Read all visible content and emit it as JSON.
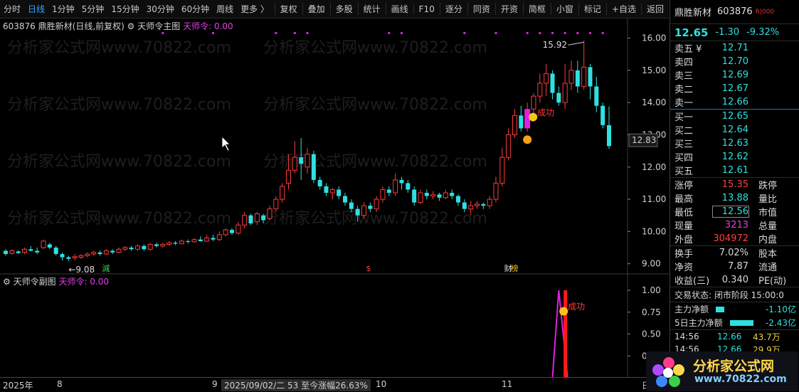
{
  "toolbar": {
    "tabs": [
      "分时",
      "日线",
      "1分钟",
      "5分钟",
      "15分钟",
      "30分钟",
      "60分钟",
      "周线",
      "更多 〉"
    ],
    "active_tab": "日线",
    "tools": [
      "复权",
      "叠加",
      "多股",
      "统计",
      "画线",
      "F10",
      "逐分",
      "同资",
      "开资",
      "简框",
      "小窗",
      "标记",
      "+自选",
      "返回"
    ]
  },
  "main_chart": {
    "code": "603876",
    "title": "鼎胜新材(日线,前复权)",
    "indicator_name": "天师令主图",
    "indicator_value": "天师令: 0.00",
    "y_ticks": [
      "16.00",
      "15.00",
      "14.00",
      "13.00",
      "12.00",
      "11.00",
      "10.00",
      "9.00"
    ],
    "current_price_label": "12.83",
    "high_label": "15.92",
    "low_label": "9.08",
    "success_label": "成功",
    "markers": [
      "減",
      "$",
      "财",
      "榜"
    ]
  },
  "sub_chart": {
    "title": "天师令副图",
    "indicator_value": "天师令: 0.00",
    "y_ticks": [
      "1.00",
      "0.75",
      "0.50",
      "0.25"
    ],
    "success_label": "成功"
  },
  "x_axis": {
    "labels": [
      "2025年",
      "8",
      "9",
      "10",
      "11"
    ],
    "cursor_info": "2025/09/02/二 53 至今涨幅26.63%",
    "right_label": "日"
  },
  "quote": {
    "name": "鼎胜新材",
    "code": "603876",
    "tag": "R|000",
    "price": "12.65",
    "change": "-1.30",
    "change_pct": "-9.32%",
    "asks": [
      {
        "label": "卖五 ¥",
        "price": "12.71"
      },
      {
        "label": "卖四",
        "price": "12.70"
      },
      {
        "label": "卖三",
        "price": "12.69"
      },
      {
        "label": "卖二",
        "price": "12.67"
      },
      {
        "label": "卖一",
        "price": "12.66"
      }
    ],
    "bids": [
      {
        "label": "买一",
        "price": "12.65"
      },
      {
        "label": "买二",
        "price": "12.64"
      },
      {
        "label": "买三",
        "price": "12.63"
      },
      {
        "label": "买四",
        "price": "12.62"
      },
      {
        "label": "买五",
        "price": "12.61"
      }
    ],
    "stats": [
      {
        "k": "涨停",
        "v": "15.35",
        "c": "red",
        "k2": "跌停"
      },
      {
        "k": "最高",
        "v": "13.88",
        "c": "cyan",
        "k2": "量比"
      },
      {
        "k": "最低",
        "v": "12.56",
        "c": "cyan",
        "k2": "市值"
      },
      {
        "k": "现量",
        "v": "3213",
        "c": "mag",
        "k2": "总量"
      },
      {
        "k": "外盘",
        "v": "304972",
        "c": "red",
        "k2": "内盘"
      }
    ],
    "stats2": [
      {
        "k": "换手",
        "v": "7.02%",
        "k2": "股本"
      },
      {
        "k": "净资",
        "v": "7.87",
        "k2": "流通"
      },
      {
        "k": "收益(三)",
        "v": "0.340",
        "k2": "PE(动)"
      }
    ],
    "trade_state": "交易状态: 闭市阶段 15:00:0",
    "flows": [
      {
        "label": "主力净额",
        "value": "-1.10亿",
        "bar": 0.2
      },
      {
        "label": "5日主力净额",
        "value": "-2.43亿",
        "bar": 0.55
      }
    ],
    "ticks": [
      {
        "time": "14:56",
        "price": "12.66",
        "vol": "43.7万"
      },
      {
        "time": "14:56",
        "price": "12.66",
        "vol": "29.9万"
      }
    ]
  },
  "logo": {
    "name": "分析家公式网",
    "url": "www.70822.com"
  },
  "watermark": "分析家公式网www.70822.com",
  "colors": {
    "up": "#ff3b3b",
    "down": "#2fe0e0",
    "magenta": "#e020e0",
    "accent": "#3aa0ff"
  },
  "chart_data": {
    "type": "candlestick",
    "candles": [
      [
        9.4,
        9.3,
        9.45,
        9.25
      ],
      [
        9.32,
        9.4,
        9.45,
        9.28
      ],
      [
        9.38,
        9.33,
        9.42,
        9.3
      ],
      [
        9.35,
        9.45,
        9.5,
        9.3
      ],
      [
        9.45,
        9.4,
        9.55,
        9.38
      ],
      [
        9.4,
        9.35,
        9.5,
        9.3
      ],
      [
        9.5,
        9.7,
        9.75,
        9.45
      ],
      [
        9.6,
        9.5,
        9.65,
        9.45
      ],
      [
        9.5,
        9.3,
        9.55,
        9.25
      ],
      [
        9.3,
        9.2,
        9.35,
        9.1
      ],
      [
        9.2,
        9.15,
        9.25,
        9.08
      ],
      [
        9.18,
        9.22,
        9.3,
        9.1
      ],
      [
        9.2,
        9.25,
        9.3,
        9.15
      ],
      [
        9.25,
        9.3,
        9.35,
        9.2
      ],
      [
        9.3,
        9.35,
        9.4,
        9.25
      ],
      [
        9.35,
        9.3,
        9.4,
        9.25
      ],
      [
        9.3,
        9.4,
        9.45,
        9.28
      ],
      [
        9.4,
        9.35,
        9.45,
        9.3
      ],
      [
        9.35,
        9.45,
        9.5,
        9.33
      ],
      [
        9.45,
        9.5,
        9.55,
        9.4
      ],
      [
        9.5,
        9.45,
        9.55,
        9.4
      ],
      [
        9.45,
        9.55,
        9.6,
        9.4
      ],
      [
        9.55,
        9.45,
        9.6,
        9.4
      ],
      [
        9.45,
        9.6,
        9.65,
        9.4
      ],
      [
        9.6,
        9.55,
        9.65,
        9.5
      ],
      [
        9.55,
        9.6,
        9.65,
        9.5
      ],
      [
        9.6,
        9.65,
        9.7,
        9.55
      ],
      [
        9.65,
        9.62,
        9.7,
        9.58
      ],
      [
        9.62,
        9.7,
        9.75,
        9.6
      ],
      [
        9.7,
        9.68,
        9.75,
        9.62
      ],
      [
        9.68,
        9.75,
        9.8,
        9.65
      ],
      [
        9.75,
        9.7,
        9.85,
        9.68
      ],
      [
        9.7,
        9.8,
        9.9,
        9.68
      ],
      [
        9.8,
        9.75,
        9.9,
        9.7
      ],
      [
        9.75,
        9.9,
        10.0,
        9.7
      ],
      [
        9.9,
        10.05,
        10.1,
        9.85
      ],
      [
        10.05,
        9.95,
        10.1,
        9.9
      ],
      [
        9.95,
        10.2,
        10.3,
        9.9
      ],
      [
        10.2,
        10.5,
        10.6,
        10.1
      ],
      [
        10.5,
        10.25,
        10.55,
        10.2
      ],
      [
        10.3,
        10.55,
        10.6,
        10.2
      ],
      [
        10.5,
        10.35,
        10.55,
        10.25
      ],
      [
        10.4,
        10.7,
        10.8,
        10.35
      ],
      [
        10.7,
        11.0,
        11.1,
        10.6
      ],
      [
        11.0,
        11.4,
        11.5,
        10.9
      ],
      [
        11.5,
        11.9,
        12.4,
        11.3
      ],
      [
        11.9,
        12.3,
        12.8,
        11.8
      ],
      [
        12.3,
        12.1,
        12.9,
        11.6
      ],
      [
        12.0,
        12.4,
        12.6,
        11.8
      ],
      [
        12.4,
        11.6,
        12.5,
        11.5
      ],
      [
        11.6,
        11.4,
        11.7,
        11.3
      ],
      [
        11.4,
        11.2,
        11.5,
        11.1
      ],
      [
        11.2,
        11.3,
        11.35,
        11.0
      ],
      [
        11.3,
        11.1,
        11.4,
        11.0
      ],
      [
        11.1,
        10.9,
        11.2,
        10.8
      ],
      [
        10.9,
        10.7,
        11.0,
        10.6
      ],
      [
        10.7,
        10.5,
        10.8,
        10.3
      ],
      [
        10.5,
        10.8,
        10.9,
        10.4
      ],
      [
        10.8,
        10.7,
        10.9,
        10.6
      ],
      [
        10.7,
        11.0,
        11.1,
        10.6
      ],
      [
        11.0,
        11.3,
        11.4,
        10.9
      ],
      [
        11.3,
        11.2,
        11.4,
        11.1
      ],
      [
        11.2,
        11.6,
        11.8,
        11.1
      ],
      [
        11.6,
        11.5,
        11.7,
        11.3
      ],
      [
        11.5,
        11.3,
        11.6,
        11.2
      ],
      [
        11.3,
        10.9,
        11.4,
        10.8
      ],
      [
        10.9,
        11.2,
        11.3,
        10.85
      ],
      [
        11.2,
        11.1,
        11.3,
        11.0
      ],
      [
        11.1,
        11.15,
        11.25,
        11.0
      ],
      [
        11.15,
        11.05,
        11.2,
        10.95
      ],
      [
        11.05,
        11.2,
        11.3,
        11.0
      ],
      [
        11.2,
        11.1,
        11.3,
        11.0
      ],
      [
        11.1,
        10.9,
        11.15,
        10.8
      ],
      [
        10.9,
        10.7,
        11.0,
        10.6
      ],
      [
        10.7,
        10.8,
        10.95,
        10.5
      ],
      [
        10.8,
        10.85,
        10.95,
        10.7
      ],
      [
        10.85,
        10.8,
        10.9,
        10.7
      ],
      [
        10.8,
        11.0,
        11.1,
        10.7
      ],
      [
        11.0,
        11.5,
        11.7,
        10.9
      ],
      [
        11.5,
        12.3,
        12.6,
        11.4
      ],
      [
        12.3,
        13.0,
        13.2,
        12.2
      ],
      [
        13.0,
        13.6,
        13.8,
        12.9
      ],
      [
        13.6,
        13.2,
        13.9,
        13.1
      ],
      [
        13.2,
        13.8,
        14.0,
        13.1
      ],
      [
        13.8,
        14.2,
        14.3,
        13.6
      ],
      [
        14.2,
        14.6,
        14.9,
        14.0
      ],
      [
        14.6,
        14.9,
        15.2,
        14.2
      ],
      [
        14.9,
        14.3,
        15.0,
        14.1
      ],
      [
        14.3,
        14.0,
        14.5,
        13.9
      ],
      [
        14.0,
        14.6,
        15.2,
        13.8
      ],
      [
        14.6,
        15.0,
        15.3,
        14.4
      ],
      [
        15.0,
        14.5,
        15.3,
        14.3
      ],
      [
        14.5,
        15.1,
        15.92,
        14.4
      ],
      [
        15.1,
        14.5,
        15.2,
        14.1
      ],
      [
        14.5,
        13.9,
        14.8,
        13.7
      ],
      [
        13.9,
        13.3,
        14.0,
        13.2
      ],
      [
        13.3,
        12.65,
        13.88,
        12.56
      ]
    ],
    "sub_line": {
      "spike_index": 88,
      "value_range": [
        0,
        1
      ]
    },
    "y_range": [
      8.75,
      16.3
    ],
    "signal_index": 83
  }
}
